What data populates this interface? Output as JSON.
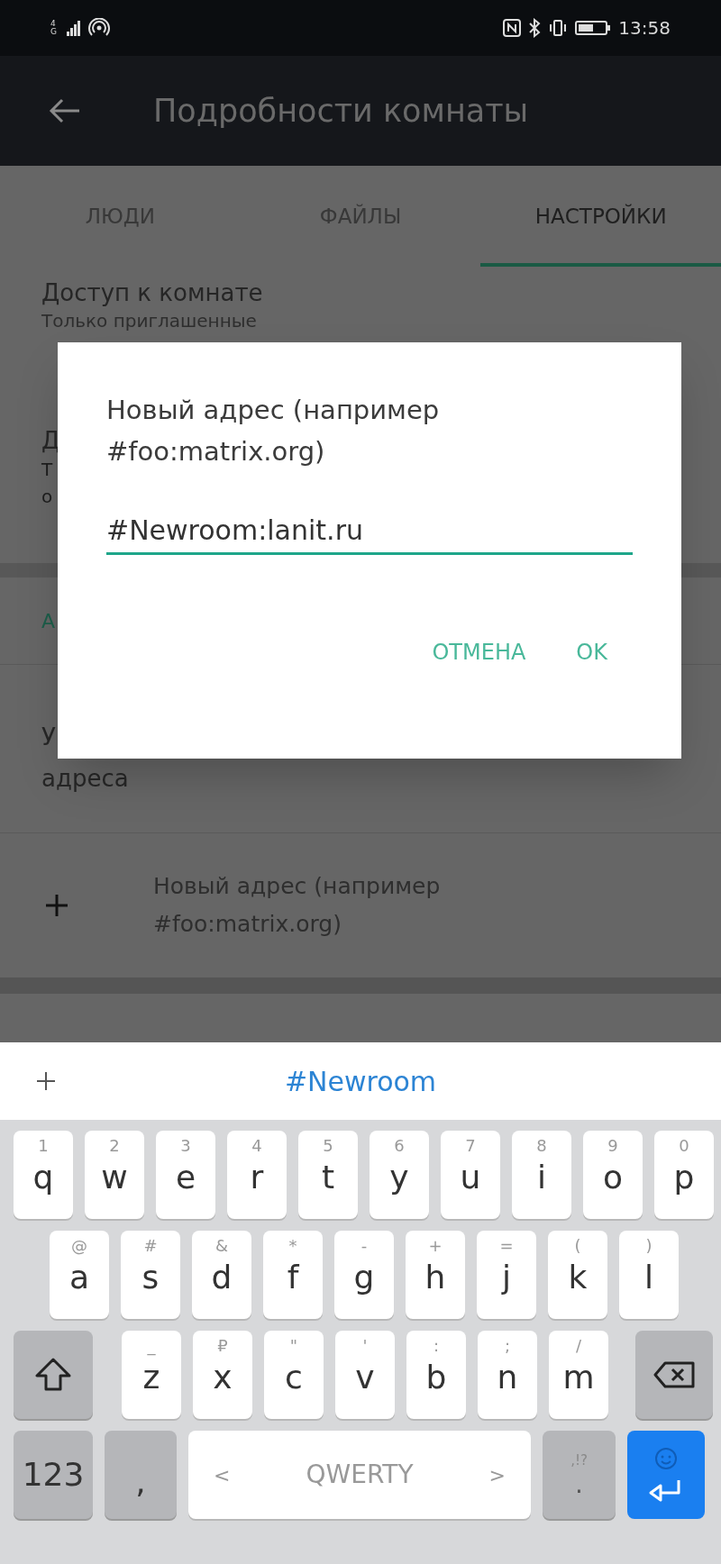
{
  "status_bar": {
    "network": "4G",
    "time": "13:58"
  },
  "app_bar": {
    "title": "Подробности комнаты"
  },
  "tabs": [
    {
      "label": "ЛЮДИ",
      "selected": false
    },
    {
      "label": "ФАЙЛЫ",
      "selected": false
    },
    {
      "label": "НАСТРОЙКИ",
      "selected": true
    }
  ],
  "background": {
    "access_title": "Доступ к комнате",
    "access_value": "Только приглашенные",
    "fragments": [
      "Д",
      "Т",
      "о"
    ],
    "section_fragment": "А",
    "list_fragment": "У",
    "list_line2": "адреса",
    "add_address": "Новый адрес (например #foo:matrix.org)"
  },
  "dialog": {
    "title": "Новый адрес (например #foo:matrix.org)",
    "value": "#Newroom:lanit.ru",
    "buttons": [
      "ОТМЕНА",
      "OK"
    ]
  },
  "keyboard": {
    "suggestion": "#Newroom",
    "rows": [
      {
        "keys": [
          {
            "kind": "key",
            "label": "q",
            "hint": "1"
          },
          {
            "kind": "key",
            "label": "w",
            "hint": "2"
          },
          {
            "kind": "key",
            "label": "e",
            "hint": "3"
          },
          {
            "kind": "key",
            "label": "r",
            "hint": "4"
          },
          {
            "kind": "key",
            "label": "t",
            "hint": "5"
          },
          {
            "kind": "key",
            "label": "y",
            "hint": "6"
          },
          {
            "kind": "key",
            "label": "u",
            "hint": "7"
          },
          {
            "kind": "key",
            "label": "i",
            "hint": "8"
          },
          {
            "kind": "key",
            "label": "o",
            "hint": "9"
          },
          {
            "kind": "key",
            "label": "p",
            "hint": "0"
          }
        ]
      },
      {
        "keys": [
          {
            "kind": "key",
            "label": "a",
            "hint": "@"
          },
          {
            "kind": "key",
            "label": "s",
            "hint": "#"
          },
          {
            "kind": "key",
            "label": "d",
            "hint": "&"
          },
          {
            "kind": "key",
            "label": "f",
            "hint": "*"
          },
          {
            "kind": "key",
            "label": "g",
            "hint": "-"
          },
          {
            "kind": "key",
            "label": "h",
            "hint": "+"
          },
          {
            "kind": "key",
            "label": "j",
            "hint": "="
          },
          {
            "kind": "key",
            "label": "k",
            "hint": "("
          },
          {
            "kind": "key",
            "label": "l",
            "hint": ")"
          }
        ]
      },
      {
        "keys": [
          {
            "kind": "shift"
          },
          {
            "kind": "key",
            "label": "z",
            "hint": "_"
          },
          {
            "kind": "key",
            "label": "x",
            "hint": "₽"
          },
          {
            "kind": "key",
            "label": "c",
            "hint": "\""
          },
          {
            "kind": "key",
            "label": "v",
            "hint": "'"
          },
          {
            "kind": "key",
            "label": "b",
            "hint": ":"
          },
          {
            "kind": "key",
            "label": "n",
            "hint": ";"
          },
          {
            "kind": "key",
            "label": "m",
            "hint": "/"
          },
          {
            "kind": "backspace"
          }
        ]
      },
      {
        "keys": [
          {
            "kind": "mode",
            "label": "123"
          },
          {
            "kind": "comma",
            "label": ","
          },
          {
            "kind": "space",
            "label": "QWERTY",
            "left": "<",
            "right": ">"
          },
          {
            "kind": "period",
            "label": ".",
            "hint": ",!?"
          },
          {
            "kind": "enter"
          }
        ]
      }
    ]
  }
}
